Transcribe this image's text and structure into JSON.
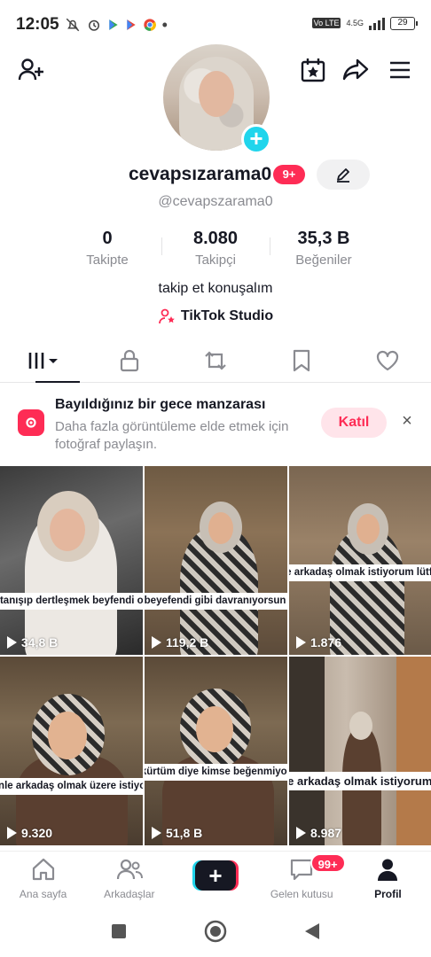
{
  "status_bar": {
    "time": "12:05",
    "volte": "Vo LTE",
    "network": "4.5G",
    "battery": "29"
  },
  "profile": {
    "username": "cevapsızarama0",
    "handle": "@cevapszarama0",
    "notification_badge": "9+",
    "bio": "takip et konuşalım",
    "studio_link": "TikTok Studio"
  },
  "stats": [
    {
      "value": "0",
      "label": "Takipte"
    },
    {
      "value": "8.080",
      "label": "Takipçi"
    },
    {
      "value": "35,3 B",
      "label": "Beğeniler"
    }
  ],
  "banner": {
    "title": "Bayıldığınız bir gece manzarası",
    "text": "Daha fazla görüntüleme elde etmek için fotoğraf paylaşın.",
    "join_label": "Katıl",
    "close_label": "×"
  },
  "videos": [
    {
      "caption": "seninle tanışıp dertleşmek beyfendi olmaz mı",
      "views": "34,8 B"
    },
    {
      "caption": "sen çok beyefendi gibi davranıyorsun yakışıklı",
      "views": "119,2 B"
    },
    {
      "caption": "seninle arkadaş olmak istiyorum lütfen çok",
      "views": "1.876"
    },
    {
      "caption": "seninle arkadaş olmak üzere istiyorum",
      "views": "9.320"
    },
    {
      "caption": "kürtüm diye kimse beğenmiyor",
      "views": "51,8 B"
    },
    {
      "caption": "seninle arkadaş olmak istiyorum lütfen",
      "views": "8.987"
    }
  ],
  "bottom_nav": {
    "home": "Ana sayfa",
    "friends": "Arkadaşlar",
    "create": "+",
    "inbox": "Gelen kutusu",
    "inbox_badge": "99+",
    "profile": "Profil"
  },
  "colors": {
    "accent": "#fe2c55",
    "cyan": "#20d5ec",
    "text": "#161823",
    "muted": "#8a8b91"
  }
}
